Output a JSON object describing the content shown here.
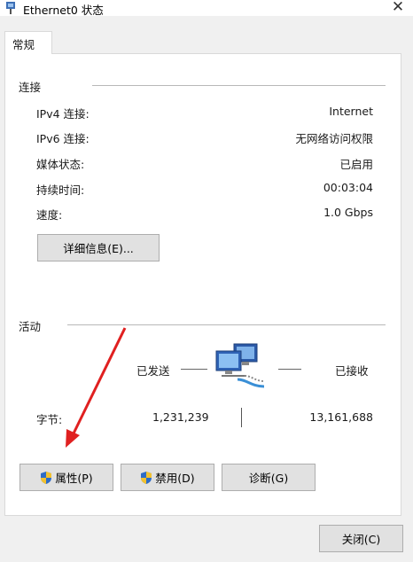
{
  "window": {
    "title": "Ethernet0 状态",
    "close_label": "✕"
  },
  "tabs": [
    {
      "label": "常规",
      "selected": true
    }
  ],
  "connection": {
    "group_label": "连接",
    "rows": [
      {
        "label": "IPv4 连接:",
        "value": "Internet"
      },
      {
        "label": "IPv6 连接:",
        "value": "无网络访问权限"
      },
      {
        "label": "媒体状态:",
        "value": "已启用"
      },
      {
        "label": "持续时间:",
        "value": "00:03:04"
      },
      {
        "label": "速度:",
        "value": "1.0 Gbps"
      }
    ],
    "details_button": "详细信息(E)..."
  },
  "activity": {
    "group_label": "活动",
    "sent_label": "已发送",
    "received_label": "已接收",
    "bytes_label": "字节:",
    "bytes_sent": "1,231,239",
    "bytes_received": "13,161,688",
    "network_icon": "network-computers-icon"
  },
  "buttons": {
    "properties": "属性(P)",
    "disable": "禁用(D)",
    "diagnose": "诊断(G)",
    "close": "关闭(C)"
  },
  "annotation": {
    "arrow_color": "#e02020"
  }
}
